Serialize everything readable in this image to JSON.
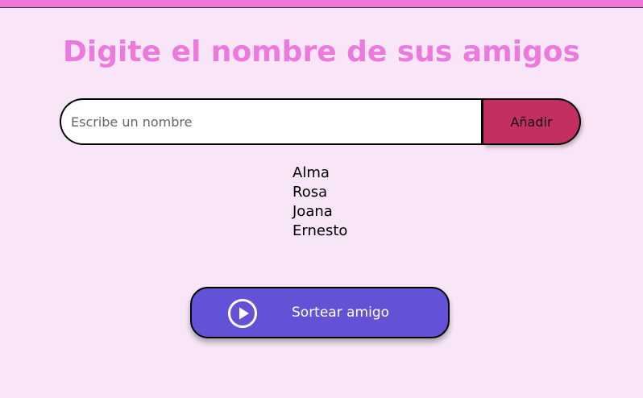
{
  "header": {
    "title": "Digite el nombre de sus amigos",
    "bar_color": "#ee76d9"
  },
  "form": {
    "input_placeholder": "Escribe un nombre",
    "input_value": "",
    "add_label": "Añadir",
    "add_color": "#c42f62"
  },
  "friends": [
    "Alma",
    "Rosa",
    "Joana",
    "Ernesto"
  ],
  "draw": {
    "label": "Sortear amigo",
    "icon": "play-circle-icon",
    "color": "#6352d6"
  },
  "colors": {
    "background": "#f8e5f7",
    "title": "#ec79dc"
  }
}
